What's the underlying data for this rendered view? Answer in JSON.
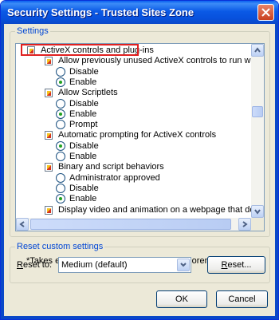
{
  "window": {
    "title": "Security Settings - Trusted Sites Zone"
  },
  "settings": {
    "legend": "Settings",
    "items": [
      {
        "kind": "category",
        "label": "ActiveX controls and plug-ins",
        "highlighted": true
      },
      {
        "kind": "setting",
        "label": "Allow previously unused ActiveX controls to run without prom"
      },
      {
        "kind": "option",
        "label": "Disable",
        "checked": false
      },
      {
        "kind": "option",
        "label": "Enable",
        "checked": true
      },
      {
        "kind": "setting",
        "label": "Allow Scriptlets"
      },
      {
        "kind": "option",
        "label": "Disable",
        "checked": false
      },
      {
        "kind": "option",
        "label": "Enable",
        "checked": true
      },
      {
        "kind": "option",
        "label": "Prompt",
        "checked": false
      },
      {
        "kind": "setting",
        "label": "Automatic prompting for ActiveX controls"
      },
      {
        "kind": "option",
        "label": "Disable",
        "checked": true
      },
      {
        "kind": "option",
        "label": "Enable",
        "checked": false
      },
      {
        "kind": "setting",
        "label": "Binary and script behaviors"
      },
      {
        "kind": "option",
        "label": "Administrator approved",
        "checked": false
      },
      {
        "kind": "option",
        "label": "Disable",
        "checked": false
      },
      {
        "kind": "option",
        "label": "Enable",
        "checked": true
      },
      {
        "kind": "setting",
        "label": "Display video and animation on a webpage that does not use"
      }
    ],
    "note": "*Takes effect after you restart Internet Explorer"
  },
  "reset": {
    "legend": "Reset custom settings",
    "label_prefix": "",
    "label_accel": "R",
    "label_rest": "eset to:",
    "selected": "Medium (default)",
    "button_accel": "R",
    "button_rest": "eset..."
  },
  "buttons": {
    "ok": "OK",
    "cancel": "Cancel"
  },
  "colors": {
    "title_bar": "#0a5ff0",
    "highlight_border": "#e02020",
    "group_label": "#0046d5"
  }
}
